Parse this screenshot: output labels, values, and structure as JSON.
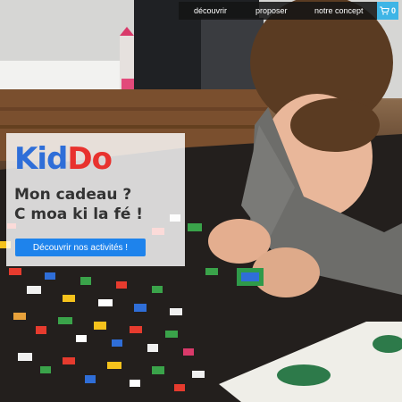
{
  "nav": {
    "items": [
      {
        "label": "découvrir"
      },
      {
        "label": "proposer"
      },
      {
        "label": "notre concept"
      }
    ]
  },
  "cart": {
    "icon": "cart-icon",
    "count": "0",
    "color": "#3fb5e6"
  },
  "hero": {
    "logo": {
      "part1": "Kid",
      "part2": "Do",
      "color1": "#2f6ed8",
      "color2": "#e8322e"
    },
    "tagline_line1": "Mon cadeau ?",
    "tagline_line2": "C moa ki la fé !",
    "cta_label": "Découvrir nos activités !",
    "cta_color": "#1e83ec"
  }
}
